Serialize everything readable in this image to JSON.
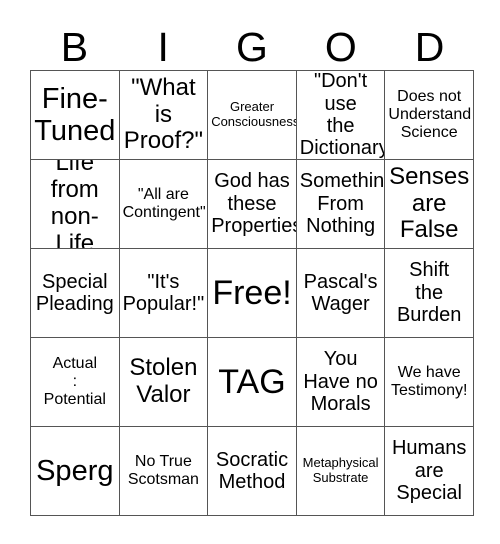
{
  "card": {
    "header_letters": [
      "B",
      "I",
      "G",
      "O",
      "D"
    ],
    "rows": [
      [
        {
          "text": "Fine-\nTuned",
          "size": "xl"
        },
        {
          "text": "\"What\nis\nProof?\"",
          "size": "l"
        },
        {
          "text": "Greater\nConsciousness",
          "size": "xs"
        },
        {
          "text": "\"Don't use\nthe\nDictionary\"",
          "size": "m"
        },
        {
          "text": "Does not\nUnderstand\nScience",
          "size": "s"
        }
      ],
      [
        {
          "text": "Life\nfrom\nnon-Life",
          "size": "l"
        },
        {
          "text": "\"All are\nContingent\"",
          "size": "s"
        },
        {
          "text": "God has\nthese\nProperties",
          "size": "m"
        },
        {
          "text": "Something\nFrom\nNothing",
          "size": "m"
        },
        {
          "text": "Senses\nare\nFalse",
          "size": "l"
        }
      ],
      [
        {
          "text": "Special\nPleading",
          "size": "m"
        },
        {
          "text": "\"It's\nPopular!\"",
          "size": "m"
        },
        {
          "text": "Free!",
          "size": "xxl"
        },
        {
          "text": "Pascal's\nWager",
          "size": "m"
        },
        {
          "text": "Shift\nthe\nBurden",
          "size": "m"
        }
      ],
      [
        {
          "text": "Actual\n:\nPotential",
          "size": "s"
        },
        {
          "text": "Stolen\nValor",
          "size": "l"
        },
        {
          "text": "TAG",
          "size": "xxl"
        },
        {
          "text": "You\nHave no\nMorals",
          "size": "m"
        },
        {
          "text": "We have\nTestimony!",
          "size": "s"
        }
      ],
      [
        {
          "text": "Sperg",
          "size": "xl"
        },
        {
          "text": "No True\nScotsman",
          "size": "s"
        },
        {
          "text": "Socratic\nMethod",
          "size": "m"
        },
        {
          "text": "Metaphysical\nSubstrate",
          "size": "xs"
        },
        {
          "text": "Humans\nare\nSpecial",
          "size": "m"
        }
      ]
    ]
  },
  "colors": {
    "background": "#ffffff",
    "text": "#000000",
    "grid_line": "#555555"
  }
}
